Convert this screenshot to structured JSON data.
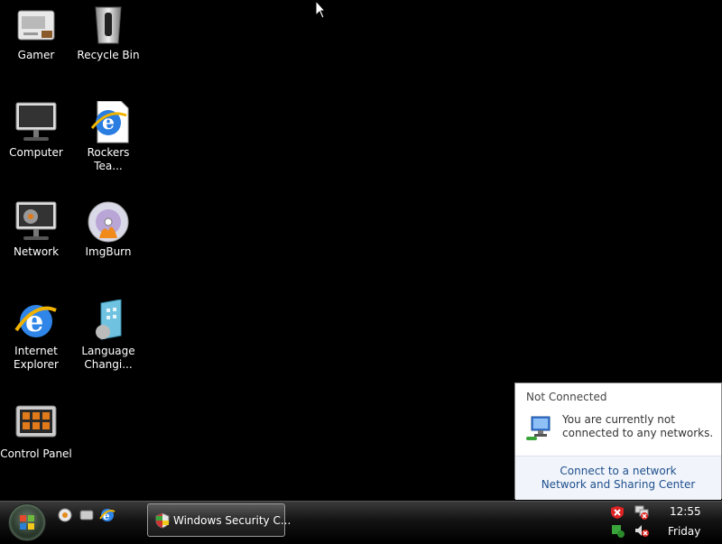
{
  "desktop": {
    "icons": [
      {
        "label": "Gamer",
        "icon": "gamer-icon"
      },
      {
        "label": "Recycle Bin",
        "icon": "recycle-bin-icon"
      },
      {
        "label": "Computer",
        "icon": "computer-icon"
      },
      {
        "label": "Rockers Tea...",
        "icon": "internet-shortcut-icon"
      },
      {
        "label": "Network",
        "icon": "network-icon"
      },
      {
        "label": "ImgBurn",
        "icon": "imgburn-icon"
      },
      {
        "label": "Internet\nExplorer",
        "icon": "internet-explorer-icon"
      },
      {
        "label": "Language\nChangi...",
        "icon": "language-changer-icon"
      },
      {
        "label": "Control Panel",
        "icon": "control-panel-icon"
      }
    ]
  },
  "notification": {
    "title": "Not Connected",
    "message": "You are currently not connected to any networks.",
    "link_connect": "Connect to a network",
    "link_sharing": "Network and Sharing Center"
  },
  "taskbar": {
    "task_button": "Windows Security C...",
    "clock_time": "12:55",
    "clock_day": "Friday"
  }
}
